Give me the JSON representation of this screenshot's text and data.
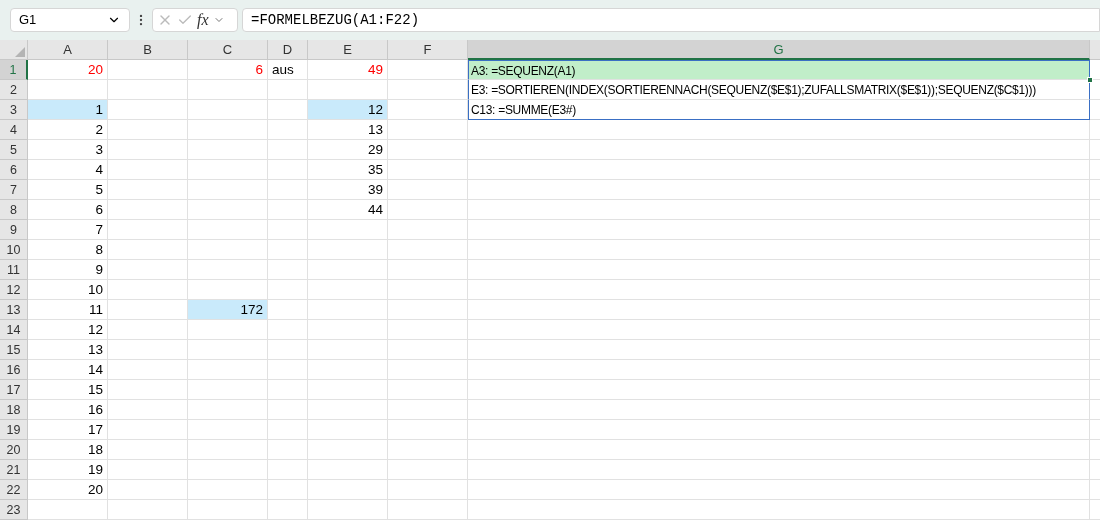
{
  "name_box": {
    "value": "G1"
  },
  "formula_bar": {
    "function_label": "fx",
    "value": "=FORMELBEZUG(A1:F22)"
  },
  "columns": [
    {
      "label": "A",
      "selected": false
    },
    {
      "label": "B",
      "selected": false
    },
    {
      "label": "C",
      "selected": false
    },
    {
      "label": "D",
      "selected": false
    },
    {
      "label": "E",
      "selected": false
    },
    {
      "label": "F",
      "selected": false
    },
    {
      "label": "G",
      "selected": true
    }
  ],
  "rows": [
    {
      "header": "1",
      "selected": true,
      "cells": [
        {
          "kind": "number",
          "text": "20",
          "color": "#ff0000",
          "selected": false,
          "highlighted": false
        },
        {
          "kind": "empty",
          "selected": false,
          "highlighted": false
        },
        {
          "kind": "number",
          "text": "6",
          "color": "#ff0000",
          "selected": false,
          "highlighted": false
        },
        {
          "kind": "text",
          "text": "aus",
          "selected": false,
          "highlighted": false
        },
        {
          "kind": "number",
          "text": "49",
          "color": "#ff0000",
          "selected": false,
          "highlighted": false
        },
        {
          "kind": "empty",
          "selected": false,
          "highlighted": false
        },
        {
          "kind": "formula",
          "text": "A3: =SEQUENZ(A1)",
          "selected": true,
          "highlighted": false
        }
      ]
    },
    {
      "header": "2",
      "selected": false,
      "cells": [
        {
          "kind": "empty",
          "selected": false,
          "highlighted": false
        },
        {
          "kind": "empty",
          "selected": false,
          "highlighted": false
        },
        {
          "kind": "empty",
          "selected": false,
          "highlighted": false
        },
        {
          "kind": "empty",
          "selected": false,
          "highlighted": false
        },
        {
          "kind": "empty",
          "selected": false,
          "highlighted": false
        },
        {
          "kind": "empty",
          "selected": false,
          "highlighted": false
        },
        {
          "kind": "formula",
          "text": "E3: =SORTIEREN(INDEX(SORTIERENNACH(SEQUENZ($E$1);ZUFALLSMATRIX($E$1));SEQUENZ($C$1)))",
          "selected": false,
          "highlighted": false
        }
      ]
    },
    {
      "header": "3",
      "selected": false,
      "cells": [
        {
          "kind": "number",
          "text": "1",
          "selected": false,
          "highlighted": true
        },
        {
          "kind": "empty",
          "selected": false,
          "highlighted": false
        },
        {
          "kind": "empty",
          "selected": false,
          "highlighted": false
        },
        {
          "kind": "empty",
          "selected": false,
          "highlighted": false
        },
        {
          "kind": "number",
          "text": "12",
          "selected": false,
          "highlighted": true
        },
        {
          "kind": "empty",
          "selected": false,
          "highlighted": false
        },
        {
          "kind": "formula",
          "text": "C13: =SUMME(E3#)",
          "selected": false,
          "highlighted": false
        }
      ]
    },
    {
      "header": "4",
      "selected": false,
      "cells": [
        {
          "kind": "number",
          "text": "2",
          "selected": false,
          "highlighted": false
        },
        {
          "kind": "empty",
          "selected": false,
          "highlighted": false
        },
        {
          "kind": "empty",
          "selected": false,
          "highlighted": false
        },
        {
          "kind": "empty",
          "selected": false,
          "highlighted": false
        },
        {
          "kind": "number",
          "text": "13",
          "selected": false,
          "highlighted": false
        },
        {
          "kind": "empty",
          "selected": false,
          "highlighted": false
        },
        {
          "kind": "empty",
          "selected": false,
          "highlighted": false
        }
      ]
    },
    {
      "header": "5",
      "selected": false,
      "cells": [
        {
          "kind": "number",
          "text": "3",
          "selected": false,
          "highlighted": false
        },
        {
          "kind": "empty",
          "selected": false,
          "highlighted": false
        },
        {
          "kind": "empty",
          "selected": false,
          "highlighted": false
        },
        {
          "kind": "empty",
          "selected": false,
          "highlighted": false
        },
        {
          "kind": "number",
          "text": "29",
          "selected": false,
          "highlighted": false
        },
        {
          "kind": "empty",
          "selected": false,
          "highlighted": false
        },
        {
          "kind": "empty",
          "selected": false,
          "highlighted": false
        }
      ]
    },
    {
      "header": "6",
      "selected": false,
      "cells": [
        {
          "kind": "number",
          "text": "4",
          "selected": false,
          "highlighted": false
        },
        {
          "kind": "empty",
          "selected": false,
          "highlighted": false
        },
        {
          "kind": "empty",
          "selected": false,
          "highlighted": false
        },
        {
          "kind": "empty",
          "selected": false,
          "highlighted": false
        },
        {
          "kind": "number",
          "text": "35",
          "selected": false,
          "highlighted": false
        },
        {
          "kind": "empty",
          "selected": false,
          "highlighted": false
        },
        {
          "kind": "empty",
          "selected": false,
          "highlighted": false
        }
      ]
    },
    {
      "header": "7",
      "selected": false,
      "cells": [
        {
          "kind": "number",
          "text": "5",
          "selected": false,
          "highlighted": false
        },
        {
          "kind": "empty",
          "selected": false,
          "highlighted": false
        },
        {
          "kind": "empty",
          "selected": false,
          "highlighted": false
        },
        {
          "kind": "empty",
          "selected": false,
          "highlighted": false
        },
        {
          "kind": "number",
          "text": "39",
          "selected": false,
          "highlighted": false
        },
        {
          "kind": "empty",
          "selected": false,
          "highlighted": false
        },
        {
          "kind": "empty",
          "selected": false,
          "highlighted": false
        }
      ]
    },
    {
      "header": "8",
      "selected": false,
      "cells": [
        {
          "kind": "number",
          "text": "6",
          "selected": false,
          "highlighted": false
        },
        {
          "kind": "empty",
          "selected": false,
          "highlighted": false
        },
        {
          "kind": "empty",
          "selected": false,
          "highlighted": false
        },
        {
          "kind": "empty",
          "selected": false,
          "highlighted": false
        },
        {
          "kind": "number",
          "text": "44",
          "selected": false,
          "highlighted": false
        },
        {
          "kind": "empty",
          "selected": false,
          "highlighted": false
        },
        {
          "kind": "empty",
          "selected": false,
          "highlighted": false
        }
      ]
    },
    {
      "header": "9",
      "selected": false,
      "cells": [
        {
          "kind": "number",
          "text": "7",
          "selected": false,
          "highlighted": false
        },
        {
          "kind": "empty",
          "selected": false,
          "highlighted": false
        },
        {
          "kind": "empty",
          "selected": false,
          "highlighted": false
        },
        {
          "kind": "empty",
          "selected": false,
          "highlighted": false
        },
        {
          "kind": "empty",
          "selected": false,
          "highlighted": false
        },
        {
          "kind": "empty",
          "selected": false,
          "highlighted": false
        },
        {
          "kind": "empty",
          "selected": false,
          "highlighted": false
        }
      ]
    },
    {
      "header": "10",
      "selected": false,
      "cells": [
        {
          "kind": "number",
          "text": "8",
          "selected": false,
          "highlighted": false
        },
        {
          "kind": "empty",
          "selected": false,
          "highlighted": false
        },
        {
          "kind": "empty",
          "selected": false,
          "highlighted": false
        },
        {
          "kind": "empty",
          "selected": false,
          "highlighted": false
        },
        {
          "kind": "empty",
          "selected": false,
          "highlighted": false
        },
        {
          "kind": "empty",
          "selected": false,
          "highlighted": false
        },
        {
          "kind": "empty",
          "selected": false,
          "highlighted": false
        }
      ]
    },
    {
      "header": "11",
      "selected": false,
      "cells": [
        {
          "kind": "number",
          "text": "9",
          "selected": false,
          "highlighted": false
        },
        {
          "kind": "empty",
          "selected": false,
          "highlighted": false
        },
        {
          "kind": "empty",
          "selected": false,
          "highlighted": false
        },
        {
          "kind": "empty",
          "selected": false,
          "highlighted": false
        },
        {
          "kind": "empty",
          "selected": false,
          "highlighted": false
        },
        {
          "kind": "empty",
          "selected": false,
          "highlighted": false
        },
        {
          "kind": "empty",
          "selected": false,
          "highlighted": false
        }
      ]
    },
    {
      "header": "12",
      "selected": false,
      "cells": [
        {
          "kind": "number",
          "text": "10",
          "selected": false,
          "highlighted": false
        },
        {
          "kind": "empty",
          "selected": false,
          "highlighted": false
        },
        {
          "kind": "empty",
          "selected": false,
          "highlighted": false
        },
        {
          "kind": "empty",
          "selected": false,
          "highlighted": false
        },
        {
          "kind": "empty",
          "selected": false,
          "highlighted": false
        },
        {
          "kind": "empty",
          "selected": false,
          "highlighted": false
        },
        {
          "kind": "empty",
          "selected": false,
          "highlighted": false
        }
      ]
    },
    {
      "header": "13",
      "selected": false,
      "cells": [
        {
          "kind": "number",
          "text": "11",
          "selected": false,
          "highlighted": false
        },
        {
          "kind": "empty",
          "selected": false,
          "highlighted": false
        },
        {
          "kind": "number",
          "text": "172",
          "selected": false,
          "highlighted": true
        },
        {
          "kind": "empty",
          "selected": false,
          "highlighted": false
        },
        {
          "kind": "empty",
          "selected": false,
          "highlighted": false
        },
        {
          "kind": "empty",
          "selected": false,
          "highlighted": false
        },
        {
          "kind": "empty",
          "selected": false,
          "highlighted": false
        }
      ]
    },
    {
      "header": "14",
      "selected": false,
      "cells": [
        {
          "kind": "number",
          "text": "12",
          "selected": false,
          "highlighted": false
        },
        {
          "kind": "empty",
          "selected": false,
          "highlighted": false
        },
        {
          "kind": "empty",
          "selected": false,
          "highlighted": false
        },
        {
          "kind": "empty",
          "selected": false,
          "highlighted": false
        },
        {
          "kind": "empty",
          "selected": false,
          "highlighted": false
        },
        {
          "kind": "empty",
          "selected": false,
          "highlighted": false
        },
        {
          "kind": "empty",
          "selected": false,
          "highlighted": false
        }
      ]
    },
    {
      "header": "15",
      "selected": false,
      "cells": [
        {
          "kind": "number",
          "text": "13",
          "selected": false,
          "highlighted": false
        },
        {
          "kind": "empty",
          "selected": false,
          "highlighted": false
        },
        {
          "kind": "empty",
          "selected": false,
          "highlighted": false
        },
        {
          "kind": "empty",
          "selected": false,
          "highlighted": false
        },
        {
          "kind": "empty",
          "selected": false,
          "highlighted": false
        },
        {
          "kind": "empty",
          "selected": false,
          "highlighted": false
        },
        {
          "kind": "empty",
          "selected": false,
          "highlighted": false
        }
      ]
    },
    {
      "header": "16",
      "selected": false,
      "cells": [
        {
          "kind": "number",
          "text": "14",
          "selected": false,
          "highlighted": false
        },
        {
          "kind": "empty",
          "selected": false,
          "highlighted": false
        },
        {
          "kind": "empty",
          "selected": false,
          "highlighted": false
        },
        {
          "kind": "empty",
          "selected": false,
          "highlighted": false
        },
        {
          "kind": "empty",
          "selected": false,
          "highlighted": false
        },
        {
          "kind": "empty",
          "selected": false,
          "highlighted": false
        },
        {
          "kind": "empty",
          "selected": false,
          "highlighted": false
        }
      ]
    },
    {
      "header": "17",
      "selected": false,
      "cells": [
        {
          "kind": "number",
          "text": "15",
          "selected": false,
          "highlighted": false
        },
        {
          "kind": "empty",
          "selected": false,
          "highlighted": false
        },
        {
          "kind": "empty",
          "selected": false,
          "highlighted": false
        },
        {
          "kind": "empty",
          "selected": false,
          "highlighted": false
        },
        {
          "kind": "empty",
          "selected": false,
          "highlighted": false
        },
        {
          "kind": "empty",
          "selected": false,
          "highlighted": false
        },
        {
          "kind": "empty",
          "selected": false,
          "highlighted": false
        }
      ]
    },
    {
      "header": "18",
      "selected": false,
      "cells": [
        {
          "kind": "number",
          "text": "16",
          "selected": false,
          "highlighted": false
        },
        {
          "kind": "empty",
          "selected": false,
          "highlighted": false
        },
        {
          "kind": "empty",
          "selected": false,
          "highlighted": false
        },
        {
          "kind": "empty",
          "selected": false,
          "highlighted": false
        },
        {
          "kind": "empty",
          "selected": false,
          "highlighted": false
        },
        {
          "kind": "empty",
          "selected": false,
          "highlighted": false
        },
        {
          "kind": "empty",
          "selected": false,
          "highlighted": false
        }
      ]
    },
    {
      "header": "19",
      "selected": false,
      "cells": [
        {
          "kind": "number",
          "text": "17",
          "selected": false,
          "highlighted": false
        },
        {
          "kind": "empty",
          "selected": false,
          "highlighted": false
        },
        {
          "kind": "empty",
          "selected": false,
          "highlighted": false
        },
        {
          "kind": "empty",
          "selected": false,
          "highlighted": false
        },
        {
          "kind": "empty",
          "selected": false,
          "highlighted": false
        },
        {
          "kind": "empty",
          "selected": false,
          "highlighted": false
        },
        {
          "kind": "empty",
          "selected": false,
          "highlighted": false
        }
      ]
    },
    {
      "header": "20",
      "selected": false,
      "cells": [
        {
          "kind": "number",
          "text": "18",
          "selected": false,
          "highlighted": false
        },
        {
          "kind": "empty",
          "selected": false,
          "highlighted": false
        },
        {
          "kind": "empty",
          "selected": false,
          "highlighted": false
        },
        {
          "kind": "empty",
          "selected": false,
          "highlighted": false
        },
        {
          "kind": "empty",
          "selected": false,
          "highlighted": false
        },
        {
          "kind": "empty",
          "selected": false,
          "highlighted": false
        },
        {
          "kind": "empty",
          "selected": false,
          "highlighted": false
        }
      ]
    },
    {
      "header": "21",
      "selected": false,
      "cells": [
        {
          "kind": "number",
          "text": "19",
          "selected": false,
          "highlighted": false
        },
        {
          "kind": "empty",
          "selected": false,
          "highlighted": false
        },
        {
          "kind": "empty",
          "selected": false,
          "highlighted": false
        },
        {
          "kind": "empty",
          "selected": false,
          "highlighted": false
        },
        {
          "kind": "empty",
          "selected": false,
          "highlighted": false
        },
        {
          "kind": "empty",
          "selected": false,
          "highlighted": false
        },
        {
          "kind": "empty",
          "selected": false,
          "highlighted": false
        }
      ]
    },
    {
      "header": "22",
      "selected": false,
      "cells": [
        {
          "kind": "number",
          "text": "20",
          "selected": false,
          "highlighted": false
        },
        {
          "kind": "empty",
          "selected": false,
          "highlighted": false
        },
        {
          "kind": "empty",
          "selected": false,
          "highlighted": false
        },
        {
          "kind": "empty",
          "selected": false,
          "highlighted": false
        },
        {
          "kind": "empty",
          "selected": false,
          "highlighted": false
        },
        {
          "kind": "empty",
          "selected": false,
          "highlighted": false
        },
        {
          "kind": "empty",
          "selected": false,
          "highlighted": false
        }
      ]
    },
    {
      "header": "23",
      "selected": false,
      "cells": [
        {
          "kind": "empty",
          "selected": false,
          "highlighted": false
        },
        {
          "kind": "empty",
          "selected": false,
          "highlighted": false
        },
        {
          "kind": "empty",
          "selected": false,
          "highlighted": false
        },
        {
          "kind": "empty",
          "selected": false,
          "highlighted": false
        },
        {
          "kind": "empty",
          "selected": false,
          "highlighted": false
        },
        {
          "kind": "empty",
          "selected": false,
          "highlighted": false
        },
        {
          "kind": "empty",
          "selected": false,
          "highlighted": false
        }
      ]
    }
  ]
}
